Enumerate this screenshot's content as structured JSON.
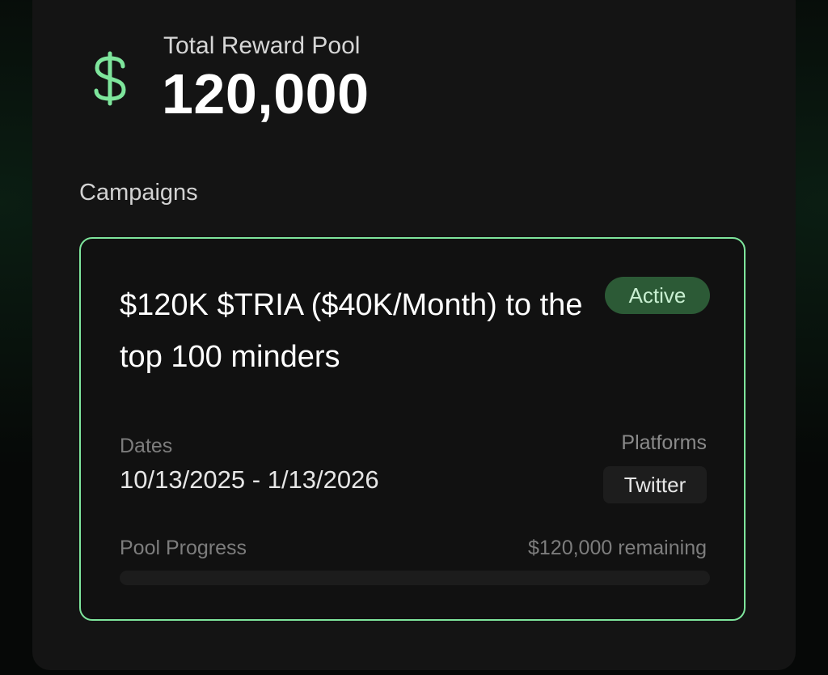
{
  "pool": {
    "icon": "dollar-icon",
    "label": "Total Reward Pool",
    "value": "120,000"
  },
  "campaigns_title": "Campaigns",
  "campaign": {
    "title": "$120K $TRIA ($40K/Month) to the top 100 minders",
    "status": "Active",
    "dates_label": "Dates",
    "dates_value": "10/13/2025 - 1/13/2026",
    "platforms_label": "Platforms",
    "platforms": [
      "Twitter"
    ],
    "progress_label": "Pool Progress",
    "remaining_text": "$120,000 remaining",
    "progress_fraction": 0
  },
  "colors": {
    "accent": "#7ee59c",
    "badge_bg": "#2c5a36",
    "panel_bg": "#141414"
  }
}
